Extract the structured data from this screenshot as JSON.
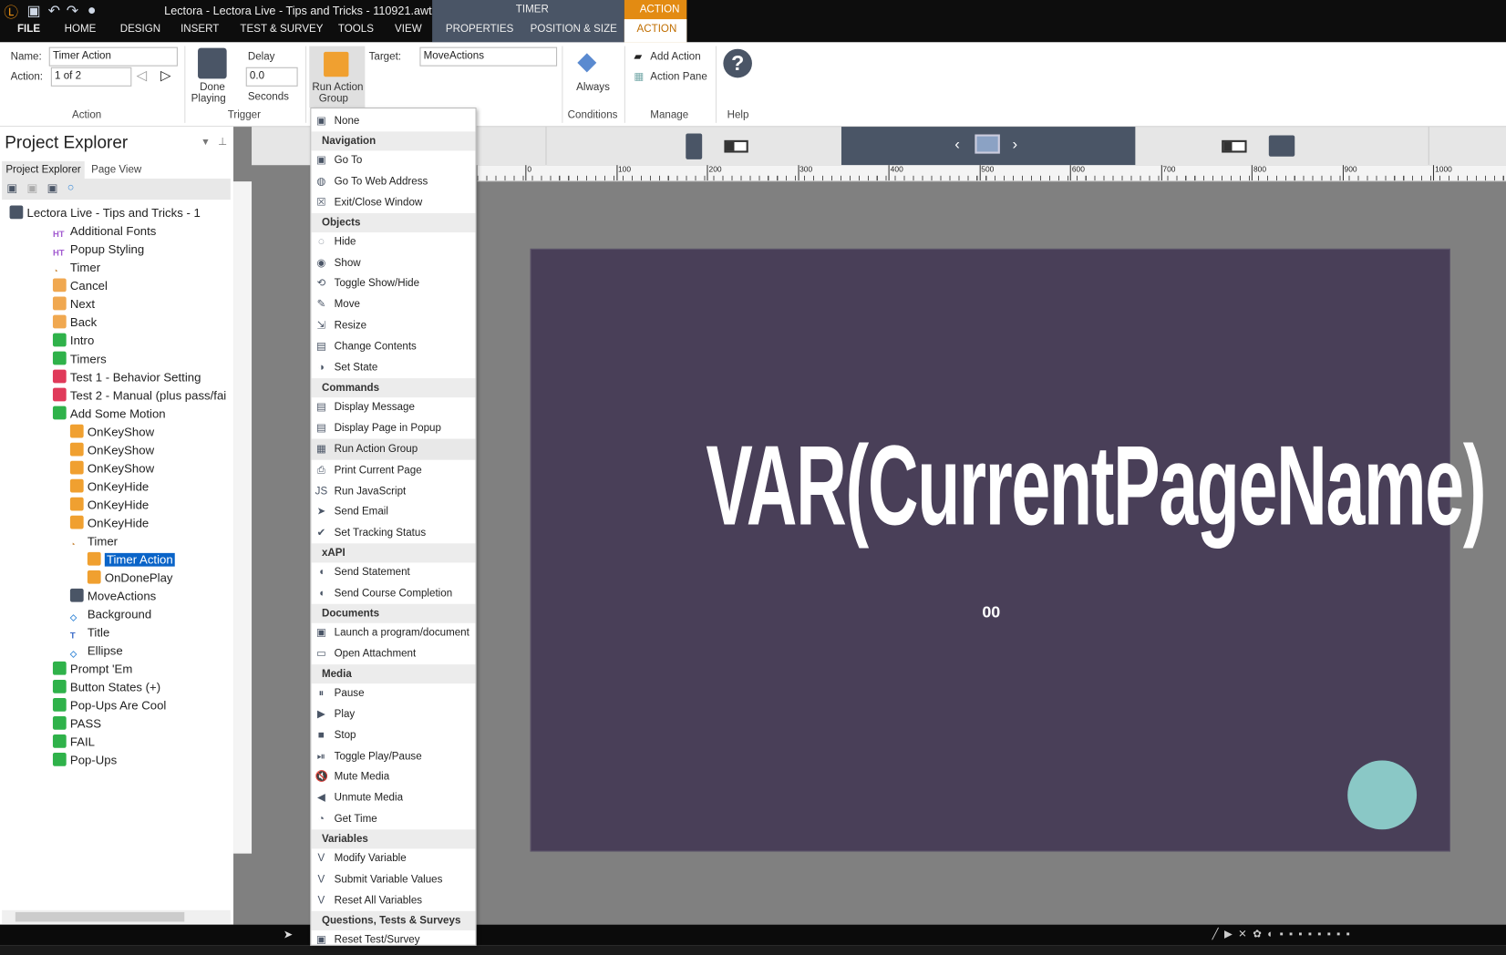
{
  "window": {
    "title": "Lectora - Lectora Live - Tips and Tricks - 110921.awt"
  },
  "ribbon_tabs": [
    "FILE",
    "HOME",
    "DESIGN",
    "INSERT",
    "TEST & SURVEY",
    "TOOLS",
    "VIEW"
  ],
  "context": {
    "group": "TIMER",
    "group2": "ACTION",
    "tabs": [
      "PROPERTIES",
      "POSITION & SIZE",
      "ACTION"
    ]
  },
  "ribbon": {
    "name_label": "Name:",
    "name_value": "Timer Action",
    "action_label": "Action:",
    "action_value": "1 of 2",
    "trigger_label": "Done",
    "trigger_label2": "Playing",
    "delay_label": "Delay",
    "delay_value": "0.0",
    "seconds_label": "Seconds",
    "action_type": "Run Action",
    "action_type2": "Group",
    "target_label": "Target:",
    "target_value": "MoveActions",
    "condition": "Always",
    "add_action": "Add Action",
    "action_pane": "Action Pane",
    "groups": {
      "action": "Action",
      "trigger": "Trigger",
      "conditions": "Conditions",
      "manage": "Manage",
      "help": "Help"
    }
  },
  "explorer": {
    "title": "Project Explorer",
    "tabs": [
      "Project Explorer",
      "Page View"
    ],
    "items": [
      {
        "label": "Lectora Live - Tips and Tricks - 1",
        "level": 0,
        "icon": "book",
        "color": "#4a5566"
      },
      {
        "label": "Additional Fonts",
        "level": 1,
        "icon": "html",
        "color": "#a25bd0"
      },
      {
        "label": "Popup Styling",
        "level": 1,
        "icon": "html",
        "color": "#a25bd0"
      },
      {
        "label": "Timer",
        "level": 1,
        "icon": "timer",
        "color": "#c98a3e"
      },
      {
        "label": "Cancel",
        "level": 1,
        "icon": "button",
        "color": "#f0a850"
      },
      {
        "label": "Next",
        "level": 1,
        "icon": "button",
        "color": "#f0a850"
      },
      {
        "label": "Back",
        "level": 1,
        "icon": "button",
        "color": "#f0a850"
      },
      {
        "label": "Intro",
        "level": 1,
        "icon": "page",
        "color": "#2fb24a"
      },
      {
        "label": "Timers",
        "level": 1,
        "icon": "page",
        "color": "#2fb24a"
      },
      {
        "label": "Test 1 - Behavior Setting",
        "level": 1,
        "icon": "test",
        "color": "#e03a5a"
      },
      {
        "label": "Test 2 - Manual (plus pass/fai",
        "level": 1,
        "icon": "test",
        "color": "#e03a5a"
      },
      {
        "label": "Add Some Motion",
        "level": 1,
        "icon": "page",
        "color": "#2fb24a"
      },
      {
        "label": "OnKeyShow",
        "level": 2,
        "icon": "action",
        "color": "#f0a030"
      },
      {
        "label": "OnKeyShow",
        "level": 2,
        "icon": "action",
        "color": "#f0a030"
      },
      {
        "label": "OnKeyShow",
        "level": 2,
        "icon": "action",
        "color": "#f0a030"
      },
      {
        "label": "OnKeyHide",
        "level": 2,
        "icon": "action",
        "color": "#f0a030"
      },
      {
        "label": "OnKeyHide",
        "level": 2,
        "icon": "action",
        "color": "#f0a030"
      },
      {
        "label": "OnKeyHide",
        "level": 2,
        "icon": "action",
        "color": "#f0a030"
      },
      {
        "label": "Timer",
        "level": 2,
        "icon": "timer",
        "color": "#c98a3e"
      },
      {
        "label": "Timer Action",
        "level": 3,
        "icon": "action",
        "color": "#f0a030",
        "selected": true
      },
      {
        "label": "OnDonePlay",
        "level": 3,
        "icon": "action",
        "color": "#f0a030"
      },
      {
        "label": "MoveActions",
        "level": 2,
        "icon": "group",
        "color": "#4a5566"
      },
      {
        "label": "Background",
        "level": 2,
        "icon": "shape",
        "color": "#3a8ad8"
      },
      {
        "label": "Title",
        "level": 2,
        "icon": "text",
        "color": "#3a6ac8"
      },
      {
        "label": "Ellipse",
        "level": 2,
        "icon": "shape",
        "color": "#3a8ad8"
      },
      {
        "label": "Prompt 'Em",
        "level": 1,
        "icon": "page",
        "color": "#2fb24a"
      },
      {
        "label": "Button States (+)",
        "level": 1,
        "icon": "page",
        "color": "#2fb24a"
      },
      {
        "label": "Pop-Ups Are Cool",
        "level": 1,
        "icon": "page",
        "color": "#2fb24a"
      },
      {
        "label": "PASS",
        "level": 1,
        "icon": "page",
        "color": "#2fb24a"
      },
      {
        "label": "FAIL",
        "level": 1,
        "icon": "page",
        "color": "#2fb24a"
      },
      {
        "label": "Pop-Ups",
        "level": 1,
        "icon": "page",
        "color": "#2fb24a"
      }
    ]
  },
  "ruler": [
    "0",
    "100",
    "200",
    "300",
    "400",
    "500",
    "600",
    "700",
    "800",
    "900",
    "1000"
  ],
  "canvas": {
    "title": "VAR(CurrentPageName)",
    "counter": "00",
    "bg": "#493f58",
    "circle": "#8ac8c6"
  },
  "menu": [
    {
      "type": "item",
      "label": "None",
      "icon": "none"
    },
    {
      "type": "header",
      "label": "Navigation"
    },
    {
      "type": "item",
      "label": "Go To",
      "icon": "goto"
    },
    {
      "type": "item",
      "label": "Go To Web Address",
      "icon": "web"
    },
    {
      "type": "item",
      "label": "Exit/Close Window",
      "icon": "close"
    },
    {
      "type": "header",
      "label": "Objects"
    },
    {
      "type": "item",
      "label": "Hide",
      "icon": "hide"
    },
    {
      "type": "item",
      "label": "Show",
      "icon": "eye"
    },
    {
      "type": "item",
      "label": "Toggle Show/Hide",
      "icon": "toggle"
    },
    {
      "type": "item",
      "label": "Move",
      "icon": "move"
    },
    {
      "type": "item",
      "label": "Resize",
      "icon": "resize"
    },
    {
      "type": "item",
      "label": "Change Contents",
      "icon": "change"
    },
    {
      "type": "item",
      "label": "Set State",
      "icon": "state"
    },
    {
      "type": "header",
      "label": "Commands"
    },
    {
      "type": "item",
      "label": "Display Message",
      "icon": "message"
    },
    {
      "type": "item",
      "label": "Display Page in Popup",
      "icon": "popup"
    },
    {
      "type": "item",
      "label": "Run Action Group",
      "icon": "group",
      "highlighted": true
    },
    {
      "type": "item",
      "label": "Print Current Page",
      "icon": "print"
    },
    {
      "type": "item",
      "label": "Run JavaScript",
      "icon": "js"
    },
    {
      "type": "item",
      "label": "Send Email",
      "icon": "email"
    },
    {
      "type": "item",
      "label": "Set Tracking Status",
      "icon": "check"
    },
    {
      "type": "header",
      "label": "xAPI"
    },
    {
      "type": "item",
      "label": "Send Statement",
      "icon": "statement"
    },
    {
      "type": "item",
      "label": "Send Course Completion",
      "icon": "completion"
    },
    {
      "type": "header",
      "label": "Documents"
    },
    {
      "type": "item",
      "label": "Launch a program/document",
      "icon": "launch"
    },
    {
      "type": "item",
      "label": "Open Attachment",
      "icon": "folder"
    },
    {
      "type": "header",
      "label": "Media"
    },
    {
      "type": "item",
      "label": "Pause",
      "icon": "pause"
    },
    {
      "type": "item",
      "label": "Play",
      "icon": "play"
    },
    {
      "type": "item",
      "label": "Stop",
      "icon": "stop"
    },
    {
      "type": "item",
      "label": "Toggle Play/Pause",
      "icon": "toggle-play"
    },
    {
      "type": "item",
      "label": "Mute Media",
      "icon": "mute"
    },
    {
      "type": "item",
      "label": "Unmute Media",
      "icon": "unmute"
    },
    {
      "type": "item",
      "label": "Get Time",
      "icon": "time"
    },
    {
      "type": "header",
      "label": "Variables"
    },
    {
      "type": "item",
      "label": "Modify Variable",
      "icon": "var"
    },
    {
      "type": "item",
      "label": "Submit Variable Values",
      "icon": "var"
    },
    {
      "type": "item",
      "label": "Reset All Variables",
      "icon": "var"
    },
    {
      "type": "header",
      "label": "Questions, Tests & Surveys"
    },
    {
      "type": "item",
      "label": "Reset Test/Survey",
      "icon": "reset"
    }
  ],
  "colors": {
    "accent": "#e38b12",
    "context": "#4a5566",
    "selection": "#0a64c8"
  }
}
